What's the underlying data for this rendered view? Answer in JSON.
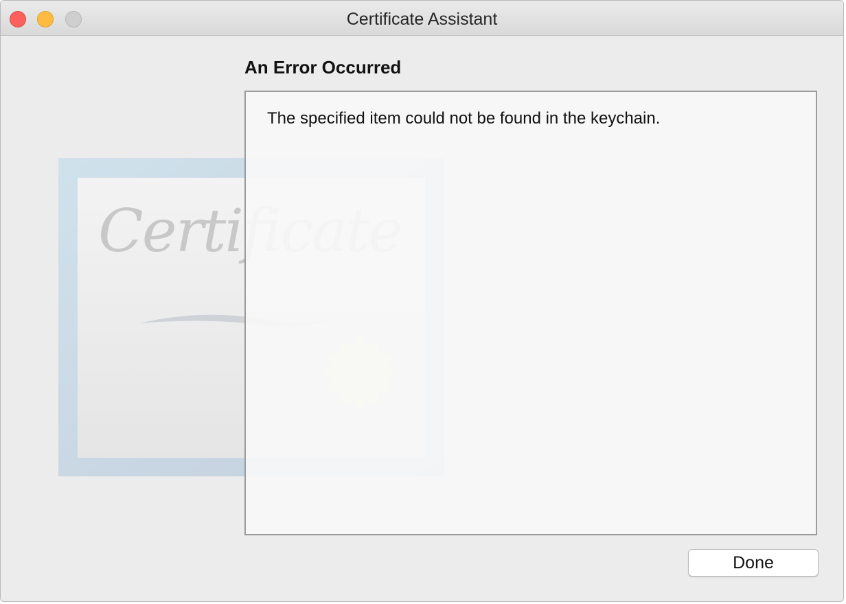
{
  "window": {
    "title": "Certificate Assistant"
  },
  "main": {
    "heading": "An Error Occurred",
    "message": "The specified item could not be found in the keychain.",
    "done_label": "Done"
  },
  "illustration": {
    "text": "Certificate",
    "icon": "certificate-icon"
  },
  "colors": {
    "close": "#fc605c",
    "minimize": "#fdbc40",
    "zoom": "#cfcfcf"
  }
}
